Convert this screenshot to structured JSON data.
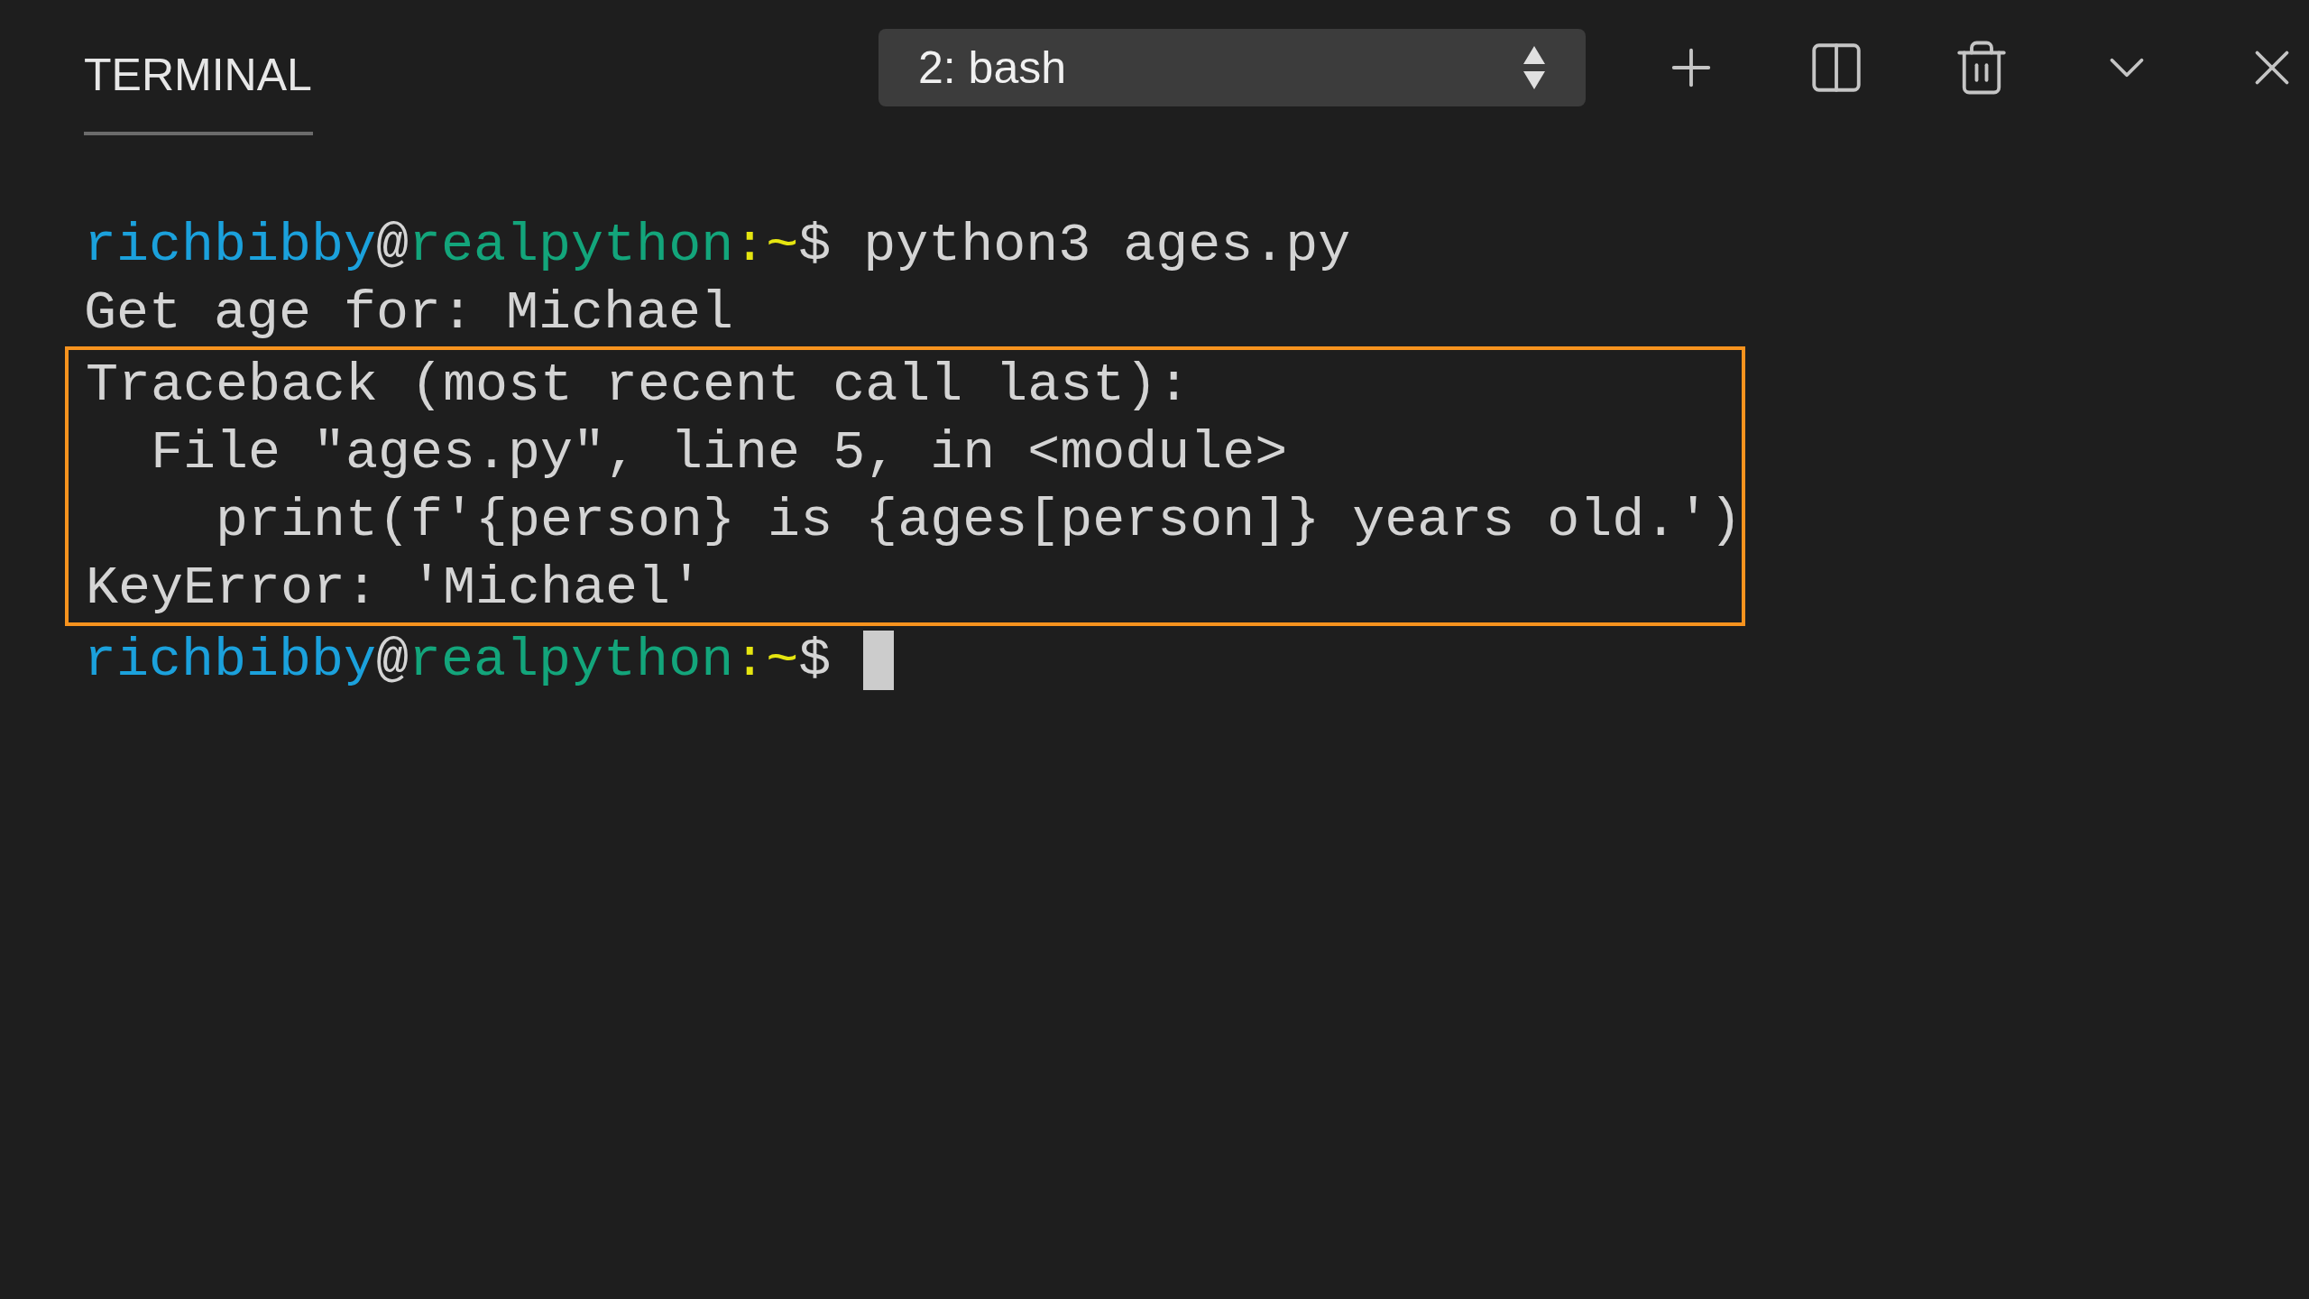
{
  "tabs": [
    {
      "label": "TERMINAL",
      "selected": true
    }
  ],
  "terminal_select": {
    "value": "2: bash"
  },
  "lines": [
    {
      "kind": "prompt",
      "user": "richbibby",
      "at": "@",
      "host": "realpython",
      "path": ":~",
      "symbol": "$",
      "command": " python3 ages.py",
      "cursor": false
    },
    {
      "kind": "output",
      "text": "Get age for: Michael"
    }
  ],
  "highlighted_lines": [
    {
      "kind": "output",
      "text": "Traceback (most recent call last):"
    },
    {
      "kind": "output",
      "text": "  File \"ages.py\", line 5, in <module>"
    },
    {
      "kind": "output",
      "text": "    print(f'{person} is {ages[person]} years old.')"
    },
    {
      "kind": "output",
      "text": "KeyError: 'Michael'"
    }
  ],
  "after_lines": [
    {
      "kind": "prompt",
      "user": "richbibby",
      "at": "@",
      "host": "realpython",
      "path": ":~",
      "symbol": "$",
      "cursor": true
    }
  ]
}
